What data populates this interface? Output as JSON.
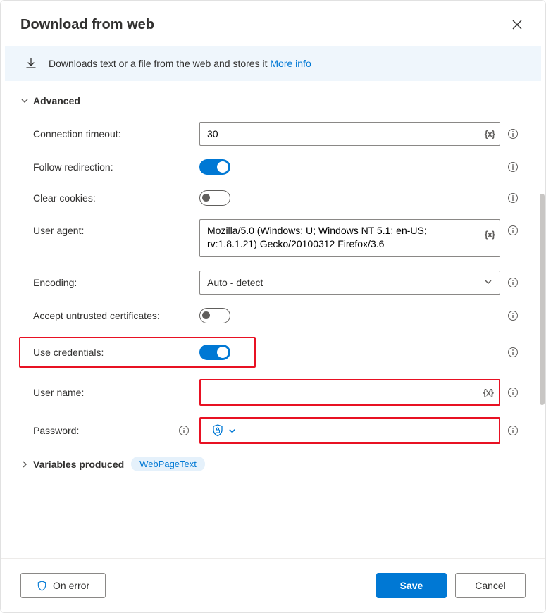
{
  "title": "Download from web",
  "banner": {
    "text": "Downloads text or a file from the web and stores it ",
    "more": "More info"
  },
  "sections": {
    "advanced": "Advanced",
    "variables": "Variables produced"
  },
  "labels": {
    "conn_timeout": "Connection timeout:",
    "follow_redir": "Follow redirection:",
    "clear_cookies": "Clear cookies:",
    "user_agent": "User agent:",
    "encoding": "Encoding:",
    "accept_untrusted": "Accept untrusted certificates:",
    "use_creds": "Use credentials:",
    "user_name": "User name:",
    "password": "Password:"
  },
  "values": {
    "conn_timeout": "30",
    "user_agent": "Mozilla/5.0 (Windows; U; Windows NT 5.1; en-US; rv:1.8.1.21) Gecko/20100312 Firefox/3.6",
    "encoding": "Auto - detect",
    "user_name": "",
    "password": ""
  },
  "toggles": {
    "follow_redir": true,
    "clear_cookies": false,
    "accept_untrusted": false,
    "use_creds": true
  },
  "var_token": "{x}",
  "variables": {
    "webpagetext": "WebPageText"
  },
  "footer": {
    "on_error": "On error",
    "save": "Save",
    "cancel": "Cancel"
  }
}
